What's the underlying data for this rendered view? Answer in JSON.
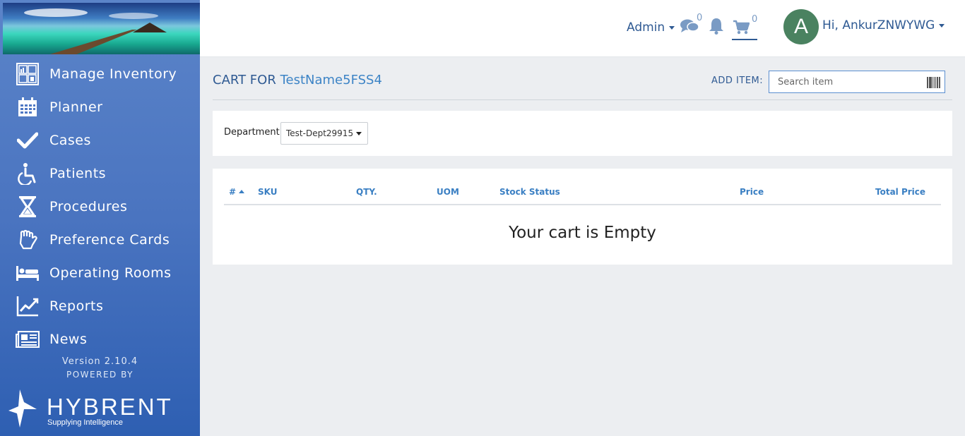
{
  "sidebar": {
    "items": [
      {
        "label": "Manage Inventory",
        "icon": "inventory-icon"
      },
      {
        "label": "Planner",
        "icon": "calendar-icon"
      },
      {
        "label": "Cases",
        "icon": "checkmark-icon"
      },
      {
        "label": "Patients",
        "icon": "wheelchair-icon"
      },
      {
        "label": "Procedures",
        "icon": "hourglass-icon"
      },
      {
        "label": "Preference Cards",
        "icon": "glove-icon"
      },
      {
        "label": "Operating Rooms",
        "icon": "bed-icon"
      },
      {
        "label": "Reports",
        "icon": "line-chart-icon"
      },
      {
        "label": "News",
        "icon": "newspaper-icon"
      }
    ],
    "version": "Version 2.10.4",
    "powered_by": "POWERED BY",
    "brand_name": "HYBRENT",
    "brand_tagline": "Supplying Intelligence"
  },
  "header": {
    "admin_label": "Admin",
    "messages_count": "0",
    "cart_count": "0",
    "avatar_letter": "A",
    "user_greeting": "Hi, AnkurZNWYWG"
  },
  "main": {
    "title_prefix": "CART FOR",
    "title_name": "TestName5FSS4",
    "add_item_label": "ADD ITEM:",
    "search_placeholder": "Search item",
    "department_label": "Department",
    "department_value": "Test-Dept29915",
    "table": {
      "columns": [
        "#",
        "SKU",
        "QTY.",
        "UOM",
        "Stock Status",
        "Price",
        "Total Price"
      ],
      "sorted_column": "#",
      "empty_message": "Your cart is Empty"
    }
  },
  "colors": {
    "accent": "#2f5a93",
    "link": "#3d84c6",
    "sidebar": "#4a74c0",
    "avatar": "#4a8260"
  }
}
